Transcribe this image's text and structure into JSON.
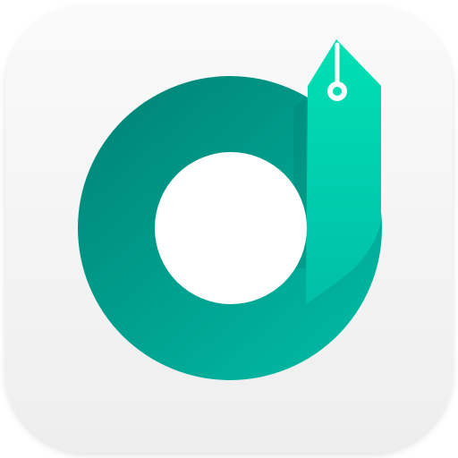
{
  "icon": {
    "name": "app-icon",
    "symbol": "letter-d-with-pen-nib",
    "colors": {
      "tile_top": "#fafafa",
      "tile_bottom": "#eeeeee",
      "ring_dark": "#00897b",
      "ring_light": "#00b8a2",
      "nib_top": "#00e0b4",
      "nib_bottom": "#00bfa8",
      "hole": "#ffffff"
    }
  }
}
